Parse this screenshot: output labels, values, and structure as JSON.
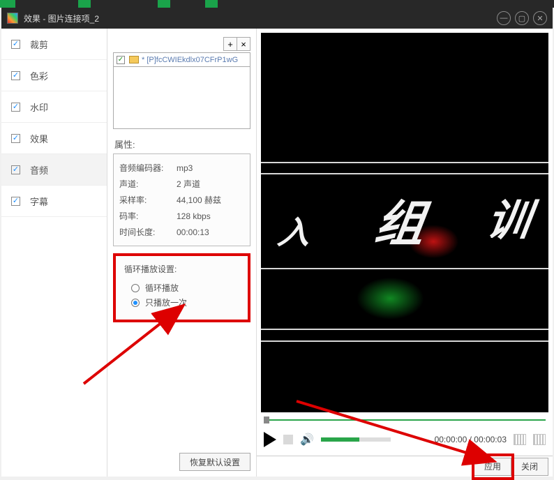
{
  "window": {
    "title": "效果 - 图片连接项_2"
  },
  "sidebar": {
    "items": [
      {
        "label": "裁剪"
      },
      {
        "label": "色彩"
      },
      {
        "label": "水印"
      },
      {
        "label": "效果"
      },
      {
        "label": "音频"
      },
      {
        "label": "字幕"
      }
    ]
  },
  "filelist": {
    "add_icon": "+",
    "remove_icon": "×",
    "item_label": "* [P]fcCWIEkdlx07CFrP1wG"
  },
  "properties": {
    "heading": "属性:",
    "rows": [
      {
        "k": "音频编码器:",
        "v": "mp3"
      },
      {
        "k": "声道:",
        "v": "2 声道"
      },
      {
        "k": "采样率:",
        "v": "44,100 赫兹"
      },
      {
        "k": "码率:",
        "v": "128 kbps"
      },
      {
        "k": "时间长度:",
        "v": "00:00:13"
      }
    ]
  },
  "loop": {
    "heading": "循环播放设置:",
    "opt_loop": "循环播放",
    "opt_once": "只播放一次"
  },
  "buttons": {
    "restore_defaults": "恢复默认设置",
    "apply": "应用",
    "close": "关闭"
  },
  "player": {
    "time": "00:00:00 / 00:00:03",
    "volume_icon": "🔊"
  }
}
